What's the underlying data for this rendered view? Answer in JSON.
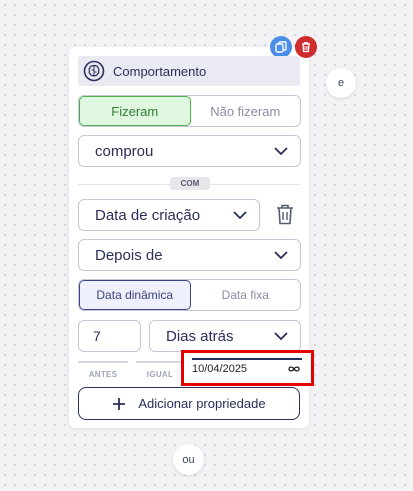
{
  "header": {
    "title": "Comportamento",
    "icon": "brain-icon"
  },
  "action_icons": [
    "copy-icon",
    "trash-icon"
  ],
  "did_segment": {
    "options": [
      "Fizeram",
      "Não fizeram"
    ],
    "selected": "Fizeram"
  },
  "event_select": {
    "value": "comprou"
  },
  "com_badge": "COM",
  "property_select": {
    "value": "Data de criação"
  },
  "operator_select": {
    "value": "Depois de"
  },
  "date_mode_segment": {
    "options": [
      "Data dinâmica",
      "Data fixa"
    ],
    "selected": "Data dinâmica"
  },
  "days_input": {
    "value": "7"
  },
  "unit_select": {
    "value": "Dias atrás"
  },
  "range_tabs": [
    "ANTES",
    "IGUAL"
  ],
  "date_field": {
    "value": "10/04/2025",
    "icon": "infinity-icon"
  },
  "add_property_button": {
    "label": "Adicionar propriedade"
  },
  "connectors": {
    "and_label": "e",
    "or_label": "ou"
  },
  "colors": {
    "accent": "#2a2f5b",
    "active_green": "#4caf50",
    "highlight_red": "#e50000"
  }
}
